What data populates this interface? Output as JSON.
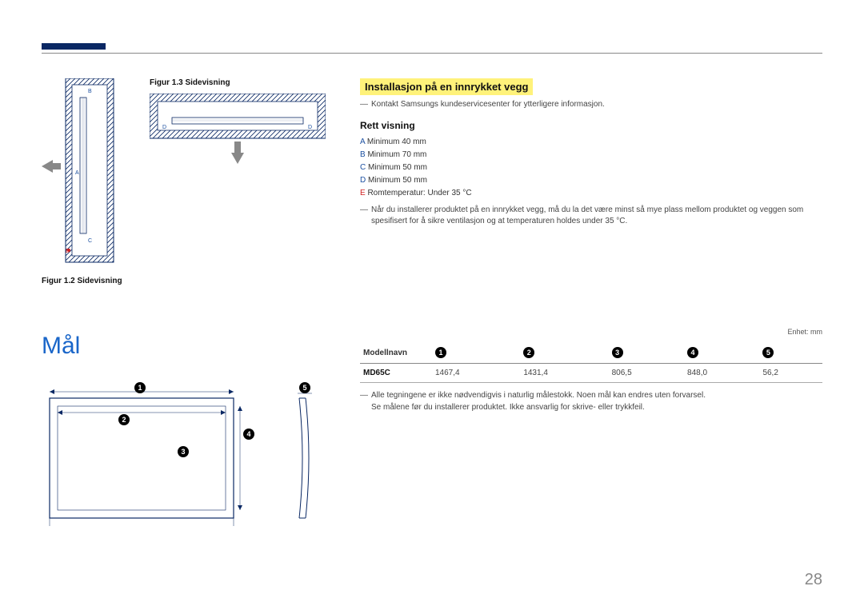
{
  "captions": {
    "fig12": "Figur 1.2 Sidevisning",
    "fig13": "Figur 1.3 Sidevisning"
  },
  "right": {
    "heading": "Installasjon på en innrykket vegg",
    "note1": "Kontakt Samsungs kundeservicesenter for ytterligere informasjon.",
    "sub": "Rett visning",
    "specs": {
      "A": {
        "label": "A",
        "text": "Minimum 40 mm"
      },
      "B": {
        "label": "B",
        "text": "Minimum 70 mm"
      },
      "C": {
        "label": "C",
        "text": "Minimum 50 mm"
      },
      "D": {
        "label": "D",
        "text": "Minimum 50 mm"
      },
      "E": {
        "label": "E",
        "text": "Romtemperatur: Under 35 °C"
      }
    },
    "note2a": "Når du installerer produktet på en innrykket vegg, må du la det være minst så mye plass mellom produktet og veggen som",
    "note2b": "spesifisert for å sikre ventilasjon og at temperaturen holdes under 35 °C."
  },
  "mal": "Mål",
  "unit": "Enhet: mm",
  "table": {
    "headers": {
      "model": "Modellnavn",
      "c1": "1",
      "c2": "2",
      "c3": "3",
      "c4": "4",
      "c5": "5"
    },
    "row": {
      "model": "MD65C",
      "v1": "1467,4",
      "v2": "1431,4",
      "v3": "806,5",
      "v4": "848,0",
      "v5": "56,2"
    },
    "note1": "Alle tegningene er ikke nødvendigvis i naturlig målestokk. Noen mål kan endres uten forvarsel.",
    "note2": "Se målene før du installerer produktet. Ikke ansvarlig for skrive- eller trykkfeil."
  },
  "diagram_labels": {
    "n1": "1",
    "n2": "2",
    "n3": "3",
    "n4": "4",
    "n5": "5"
  },
  "pagenum": "28"
}
